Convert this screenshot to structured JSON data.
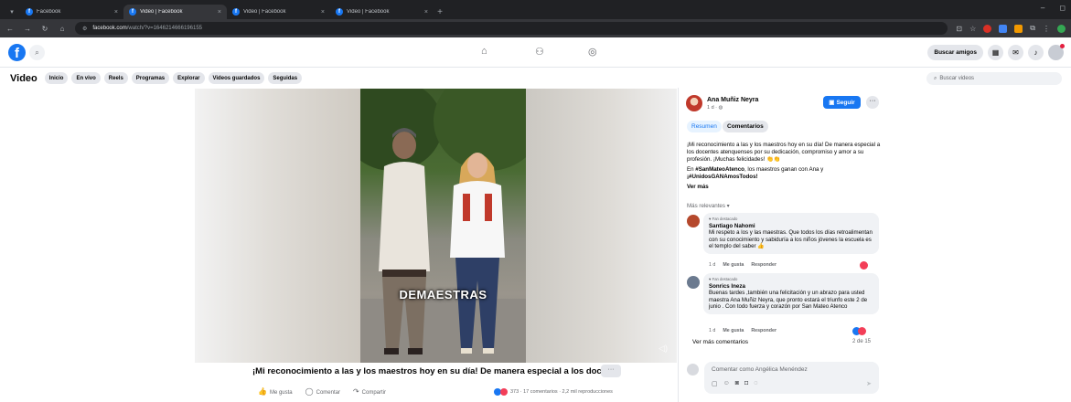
{
  "browser": {
    "tabs": [
      {
        "title": "Facebook",
        "active": false
      },
      {
        "title": "Video | Facebook",
        "active": true
      },
      {
        "title": "Video | Facebook",
        "active": false
      },
      {
        "title": "Video | Facebook",
        "active": false
      }
    ],
    "url_host": "facebook.com",
    "url_path": "/watch/?v=1646214666196155"
  },
  "fb": {
    "logo": "f",
    "find_friends": "Buscar amigos"
  },
  "video_nav": {
    "title": "Video",
    "chips": [
      "Inicio",
      "En vivo",
      "Reels",
      "Programas",
      "Explorar",
      "Videos guardados",
      "Seguidas"
    ],
    "search_placeholder": "Buscar videos"
  },
  "video": {
    "overlay_text": "DEMAESTRAS",
    "caption": "¡Mi reconocimiento a las y los maestros hoy en su día! De manera especial a los doc...",
    "more": "···",
    "actions": [
      {
        "icon": "like-icon",
        "label": "Me gusta"
      },
      {
        "icon": "comment-icon",
        "label": "Comentar"
      },
      {
        "icon": "share-icon",
        "label": "Compartir"
      }
    ],
    "stats": "373 · 17 comentarios · 2,2 mil reproducciones"
  },
  "post": {
    "author": "Ana Muñiz Neyra",
    "time": "1 d · ◍",
    "follow_label": "Seguir",
    "tab_summary": "Resumen",
    "tab_comments": "Comentarios",
    "desc_1": "¡Mi reconocimiento a las y los maestros hoy en su día! De manera especial a los docentes atenquenses por su dedicación, compromiso y amor a su profesión. ¡Muchas felicidades! 👏👏",
    "desc_2a": "En ",
    "desc_2b": "#SanMateoAtenco",
    "desc_2c": ", los maestros ganan con Ana y ",
    "desc_2d": "¡#UnidosGANAmosTodos!",
    "see_more": "Ver más",
    "sort_label": "Más relevantes ▾"
  },
  "comments": [
    {
      "badge": "♥ Fan destacado",
      "name": "Santiago Nahomi",
      "text": "Mi respeto a los y las maestras. Que todos los días retroalimentan con su conocimiento y sabiduría a los niños jóvenes la escuela es el templo del saber 👍",
      "time": "1 d",
      "like": "Me gusta",
      "reply": "Responder"
    },
    {
      "badge": "♥ Fan destacado",
      "name": "Sonrics Ineza",
      "text": "Buenas tardes ,también una felicitación y un abrazo para usted maestra Ana Muñiz Neyra, que pronto estará el triunfo este 2 de junio . Con todo fuerza y corazón por San Mateo Atenco",
      "time": "1 d",
      "like": "Me gusta",
      "reply": "Responder"
    }
  ],
  "more_comments": "Ver más comentarios",
  "comment_count": "2 de 15",
  "composer_placeholder": "Comentar como Angélica Menéndez",
  "colors": {
    "brand": "#1877f2",
    "like_reaction": "#1877f2",
    "love_reaction": "#f33e58"
  }
}
